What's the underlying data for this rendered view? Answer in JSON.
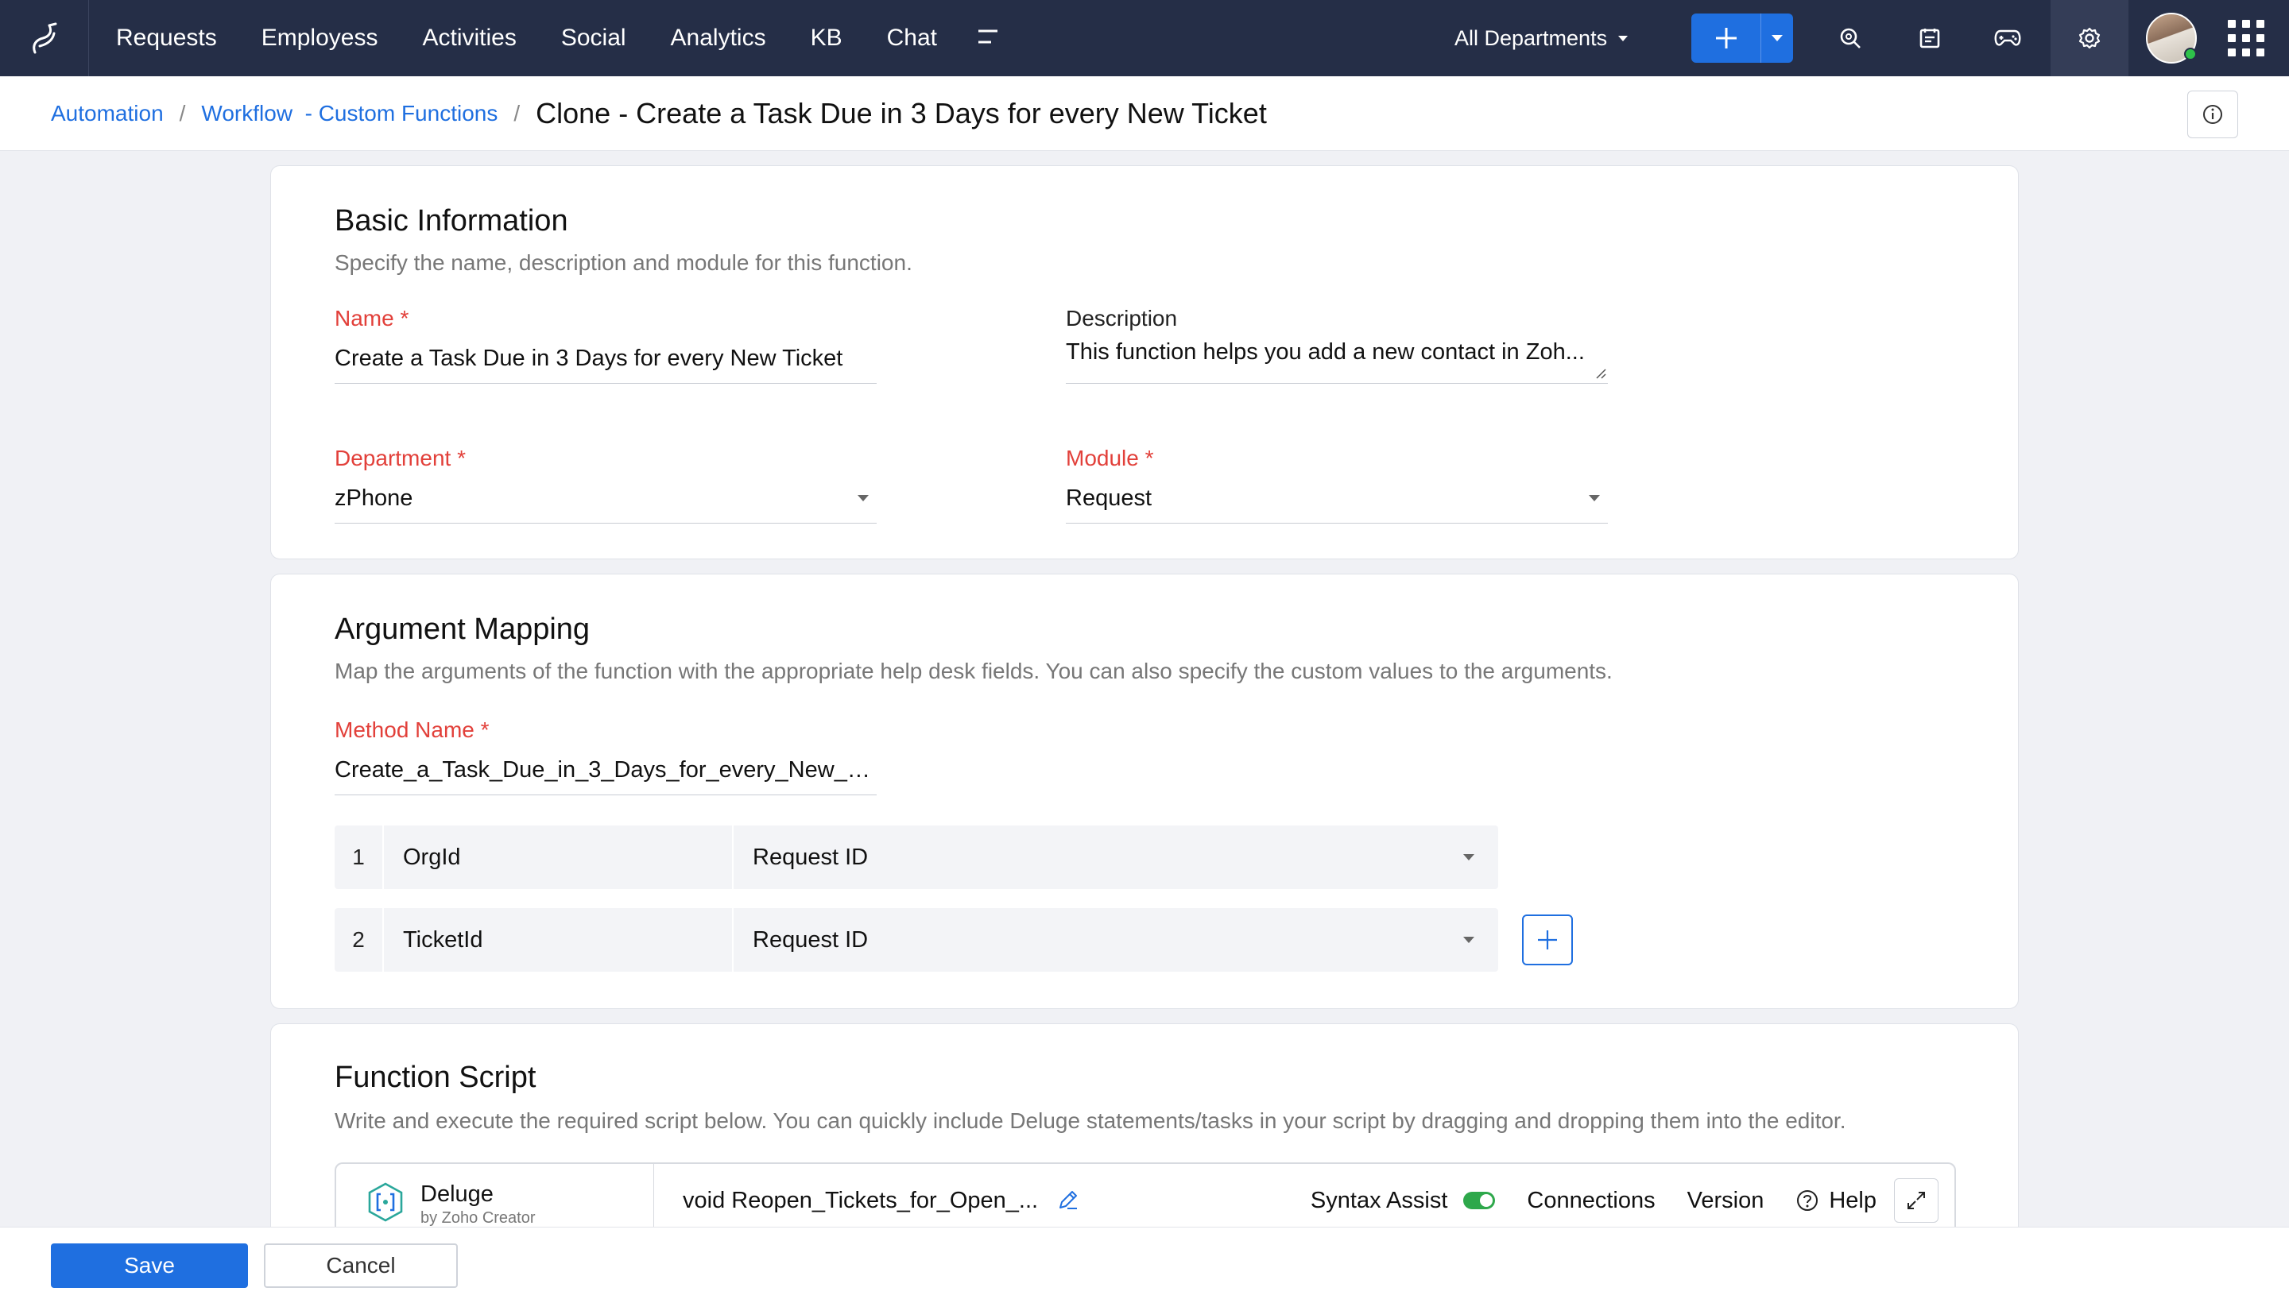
{
  "topbar": {
    "nav": [
      "Requests",
      "Employess",
      "Activities",
      "Social",
      "Analytics",
      "KB",
      "Chat"
    ],
    "department_selector": "All Departments",
    "icons": [
      "desk-logo-icon",
      "more-menu-icon",
      "plus-icon",
      "chevron-down-icon",
      "search-icon",
      "notepad-icon",
      "gamepad-icon",
      "gear-icon",
      "avatar",
      "apps-grid-icon"
    ]
  },
  "breadcrumb": {
    "items": [
      "Automation",
      "Workflow  - Custom Functions"
    ],
    "current": "Clone - Create a Task Due in 3 Days for every New Ticket"
  },
  "basic_info": {
    "title": "Basic Information",
    "subtitle": "Specify the name, description and module for this function.",
    "name_label": "Name",
    "name_value": "Create a Task Due in 3 Days for every New Ticket",
    "description_label": "Description",
    "description_value": "This function helps you add a new contact in Zoh...",
    "department_label": "Department",
    "department_value": "zPhone",
    "module_label": "Module",
    "module_value": "Request",
    "required_mark": "*"
  },
  "argument_mapping": {
    "title": "Argument Mapping",
    "subtitle": "Map the arguments of the function with the appropriate help desk fields. You can also specify the custom values to the arguments.",
    "method_label": "Method Name",
    "method_value": "Create_a_Task_Due_in_3_Days_for_every_New_Tic...",
    "rows": [
      {
        "num": "1",
        "arg": "OrgId",
        "value": "Request ID"
      },
      {
        "num": "2",
        "arg": "TicketId",
        "value": "Request ID"
      }
    ]
  },
  "function_script": {
    "title": "Function Script",
    "subtitle": "Write and execute the required script below. You can quickly include Deluge statements/tasks in your script by dragging and dropping them into the editor.",
    "deluge_title": "Deluge",
    "deluge_sub": "by Zoho Creator",
    "signature": "void Reopen_Tickets_for_Open_...",
    "syntax_assist": "Syntax Assist",
    "connections": "Connections",
    "version": "Version",
    "help": "Help"
  },
  "footer": {
    "save": "Save",
    "cancel": "Cancel"
  },
  "colors": {
    "topbar": "#252e47",
    "accent": "#1f6fe0",
    "required": "#e2403a",
    "toggle_on": "#2ea84b"
  }
}
